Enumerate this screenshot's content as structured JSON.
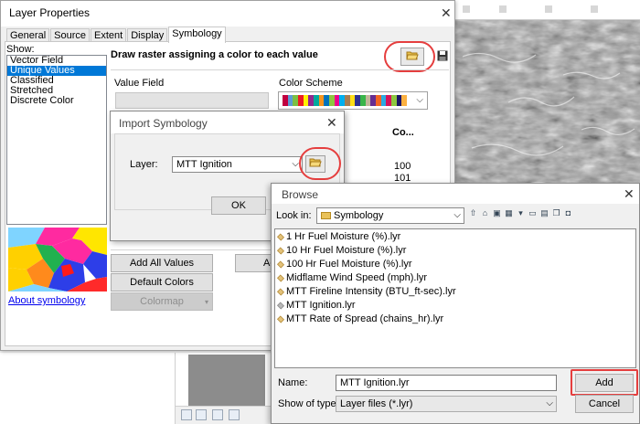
{
  "layer_properties": {
    "title": "Layer Properties",
    "tabs": [
      "General",
      "Source",
      "Extent",
      "Display",
      "Symbology"
    ],
    "active_tab": "Symbology",
    "show_label": "Show:",
    "show_items": [
      "Vector Field",
      "Unique Values",
      "Classified",
      "Stretched",
      "Discrete Color"
    ],
    "selected_show_item": "Unique Values",
    "heading": "Draw raster assigning a color to each value",
    "value_field_label": "Value Field",
    "value_field_value": "",
    "color_scheme_label": "Color Scheme",
    "color_scheme_colors": [
      "#c00040",
      "#5b9bd5",
      "#7cbf42",
      "#ed1c24",
      "#fff200",
      "#92278f",
      "#00a99d",
      "#f7941d",
      "#0072bc",
      "#8dc63f",
      "#ec008c",
      "#00aeef",
      "#a67c52",
      "#ffde17",
      "#2e3192",
      "#39b54a",
      "#c2b59b",
      "#662d91",
      "#f26522",
      "#29abe2",
      "#d4145a",
      "#8cc63f",
      "#1b1464",
      "#fbb040"
    ],
    "table_header": "Co...",
    "table_values": [
      "100",
      "101"
    ],
    "add_all_values": "Add All Values",
    "add_partial": "Ad",
    "default_colors": "Default Colors",
    "colormap": "Colormap",
    "about_link": "About symbology"
  },
  "import_dialog": {
    "title": "Import Symbology",
    "layer_label": "Layer:",
    "layer_value": "MTT Ignition",
    "ok_label": "OK"
  },
  "browse_dialog": {
    "title": "Browse",
    "look_in_label": "Look in:",
    "look_in_value": "Symbology",
    "files": [
      "1 Hr Fuel Moisture (%).lyr",
      "10 Hr Fuel Moisture (%).lyr",
      "100 Hr Fuel Moisture (%).lyr",
      "Midflame Wind Speed (mph).lyr",
      "MTT Fireline Intensity (BTU_ft-sec).lyr",
      "MTT Ignition.lyr",
      "MTT Rate of Spread (chains_hr).lyr"
    ],
    "name_label": "Name:",
    "name_value": "MTT Ignition.lyr",
    "type_label": "Show of type:",
    "type_value": "Layer files (*.lyr)",
    "add_label": "Add",
    "cancel_label": "Cancel"
  },
  "colors": {
    "highlight": "#e53e3e",
    "selection": "#0078d7",
    "link": "#0000ee"
  }
}
